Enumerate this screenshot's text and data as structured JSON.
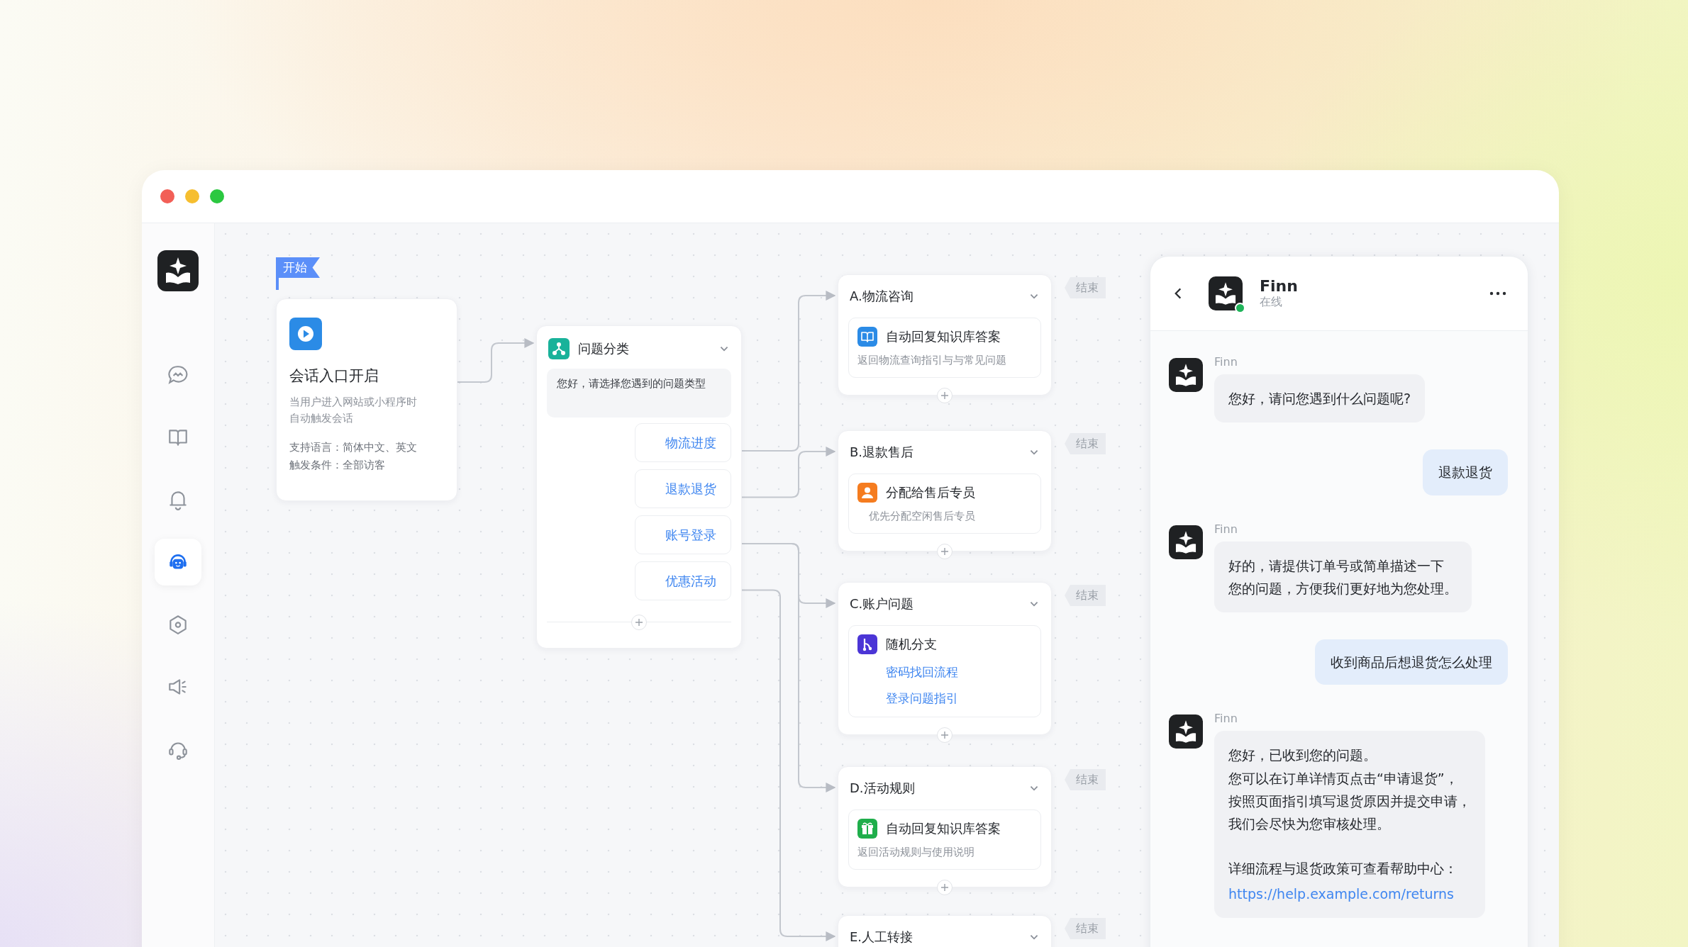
{
  "sidebar": {
    "items": [
      {
        "kind": "chat",
        "selected": false
      },
      {
        "kind": "book",
        "selected": false
      },
      {
        "kind": "bell",
        "selected": false
      },
      {
        "kind": "bot",
        "selected": true
      },
      {
        "kind": "hexagon",
        "selected": false
      },
      {
        "kind": "speaker",
        "selected": false
      },
      {
        "kind": "headset",
        "selected": false
      }
    ]
  },
  "canvas": {
    "start_flag": "开始",
    "start_node": {
      "title": "会话入口开启",
      "description": "当用户进入网站或小程序时自动触发会话",
      "details": [
        "支持语言：简体中文、英文",
        "触发条件：全部访客"
      ]
    },
    "classifier": {
      "title": "问题分类",
      "prompt": "您好，请选择您遇到的问题类型",
      "options": [
        "物流进度",
        "退款退货",
        "账号登录",
        "优惠活动"
      ]
    },
    "branches": [
      {
        "title": "A.物流咨询",
        "end_label": "结束",
        "action": {
          "kind": "knowledge",
          "title": "自动回复知识库答案",
          "description": "返回物流查询指引与与常见问题"
        }
      },
      {
        "title": "B.退款售后",
        "end_label": "结束",
        "action": {
          "kind": "assign",
          "title": "分配给售后专员",
          "description": "优先分配空闲售后专员"
        }
      },
      {
        "title": "C.账户问题",
        "end_label": "结束",
        "action": {
          "kind": "random",
          "title": "随机分支",
          "links": [
            "密码找回流程",
            "登录问题指引"
          ]
        }
      },
      {
        "title": "D.活动规则",
        "end_label": "结束",
        "action": {
          "kind": "gift",
          "title": "自动回复知识库答案",
          "description": "返回活动规则与使用说明"
        }
      },
      {
        "title": "E.人工转接",
        "end_label": "结束"
      }
    ]
  },
  "chat": {
    "name": "Finn",
    "status": "在线",
    "online": true,
    "messages": [
      {
        "kind": "bot",
        "sender": "Finn",
        "lines": [
          "您好，请问您遇到什么问题呢?"
        ]
      },
      {
        "kind": "user",
        "lines": [
          "退款退货"
        ]
      },
      {
        "kind": "bot",
        "sender": "Finn",
        "lines": [
          "好的，请提供订单号或简单描述一下",
          "您的问题，方便我们更好地为您处理。"
        ]
      },
      {
        "kind": "user",
        "lines": [
          "收到商品后想退货怎么处理"
        ]
      },
      {
        "kind": "bot",
        "sender": "Finn",
        "lines": [
          "您好，已收到您的问题。",
          "您可以在订单详情页点击“申请退货”，",
          "按照页面指引填写退货原因并提交申请，",
          "我们会尽快为您审核处理。"
        ],
        "note": "详细流程与退货政策可查看帮助中心：",
        "link": "https://help.example.com/returns"
      }
    ]
  }
}
